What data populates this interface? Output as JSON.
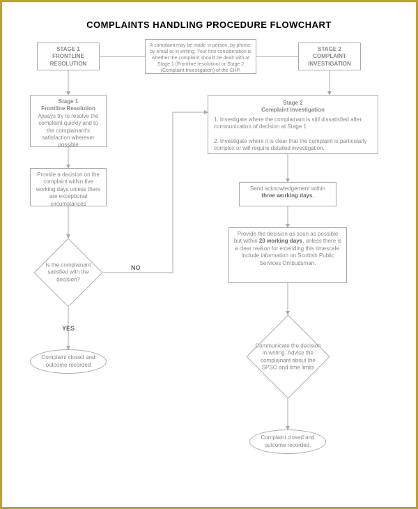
{
  "title": "COMPLAINTS HANDLING PROCEDURE FLOWCHART",
  "chart_data": {
    "type": "flowchart",
    "nodes": [
      {
        "id": "stage1hdr",
        "shape": "rect",
        "text": "STAGE 1 FRONTLINE RESOLUTION",
        "bold": true
      },
      {
        "id": "intro",
        "shape": "rect",
        "text": "A complaint may be made in person, by phone, by email or in writing. Your first consideration is whether the complaint should be dealt with at Stage 1 (Frontline resolution) or Stage 2 (Complaint Investigation) of the CHP."
      },
      {
        "id": "stage2hdr",
        "shape": "rect",
        "text": "STAGE 2 COMPLAINT INVESTIGATION",
        "bold": true
      },
      {
        "id": "s1title",
        "shape": "rect",
        "text_bold": "Stage 1\nFrontline Resolution",
        "text": "Always try to resolve the complaint quickly and to the complainant's satisfaction wherever possible"
      },
      {
        "id": "s1decision",
        "shape": "rect",
        "text": "Provide a decision on the complaint within five working days unless there are exceptional circumstances"
      },
      {
        "id": "satisfied",
        "shape": "diamond",
        "text": "Is the complainant satisfied with the decision?"
      },
      {
        "id": "closed1",
        "shape": "terminator",
        "text": "Complaint closed and outcome recorded"
      },
      {
        "id": "s2title",
        "shape": "rect",
        "text_bold": "Stage 2\nComplaint Investigation",
        "text": "1. Investigate where the complainant is still dissatisfied after communication of decision at Stage 1\n\n2. Investigate where it is clear that the complaint is particularly complex or will require detailed investigation."
      },
      {
        "id": "ack",
        "shape": "rect",
        "text_pre": "Send acknowledgement within ",
        "text_bold": "three working days."
      },
      {
        "id": "provide",
        "shape": "rect",
        "text_pre": "Provide the decision as soon as possible but within ",
        "text_bold": "20 working days",
        "text_post": ", unless there is a clear reason for extending this timescale. Include information on Scottish Public Services Ombudsman."
      },
      {
        "id": "communicate",
        "shape": "diamond",
        "text": "Communicate the decision in writing. Advise the complainant about the SPSO and time limits"
      },
      {
        "id": "closed2",
        "shape": "terminator",
        "text": "Complaint closed and outcome recorded."
      }
    ],
    "edges": [
      {
        "from": "stage1hdr",
        "to": "intro"
      },
      {
        "from": "intro",
        "to": "stage2hdr"
      },
      {
        "from": "stage1hdr",
        "to": "s1title"
      },
      {
        "from": "s1title",
        "to": "s1decision"
      },
      {
        "from": "s1decision",
        "to": "satisfied"
      },
      {
        "from": "satisfied",
        "to": "closed1",
        "label": "YES"
      },
      {
        "from": "satisfied",
        "to": "s2title",
        "label": "NO"
      },
      {
        "from": "stage2hdr",
        "to": "s2title"
      },
      {
        "from": "s2title",
        "to": "ack"
      },
      {
        "from": "ack",
        "to": "provide"
      },
      {
        "from": "provide",
        "to": "communicate"
      },
      {
        "from": "communicate",
        "to": "closed2"
      }
    ],
    "labels": {
      "yes": "YES",
      "no": "NO"
    }
  }
}
